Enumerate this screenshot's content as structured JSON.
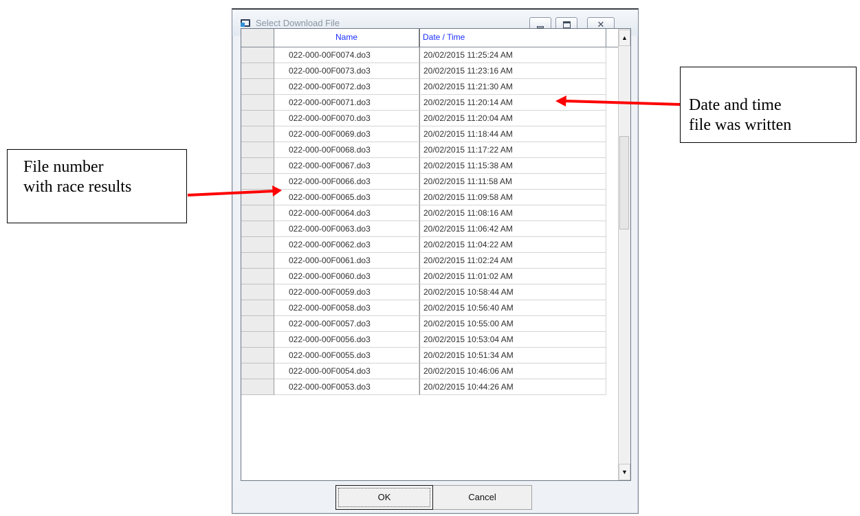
{
  "window": {
    "title": "Select Download File",
    "icon": "app-window-icon",
    "controls": [
      "minimize-icon",
      "maximize-icon",
      "close-icon"
    ]
  },
  "table": {
    "columns": [
      "Name",
      "Date / Time"
    ],
    "rows": [
      {
        "name": "022-000-00F0074.do3",
        "datetime": "20/02/2015 11:25:24 AM"
      },
      {
        "name": "022-000-00F0073.do3",
        "datetime": "20/02/2015 11:23:16 AM"
      },
      {
        "name": "022-000-00F0072.do3",
        "datetime": "20/02/2015 11:21:30 AM"
      },
      {
        "name": "022-000-00F0071.do3",
        "datetime": "20/02/2015 11:20:14 AM"
      },
      {
        "name": "022-000-00F0070.do3",
        "datetime": "20/02/2015 11:20:04 AM"
      },
      {
        "name": "022-000-00F0069.do3",
        "datetime": "20/02/2015 11:18:44 AM"
      },
      {
        "name": "022-000-00F0068.do3",
        "datetime": "20/02/2015 11:17:22 AM"
      },
      {
        "name": "022-000-00F0067.do3",
        "datetime": "20/02/2015 11:15:38 AM"
      },
      {
        "name": "022-000-00F0066.do3",
        "datetime": "20/02/2015 11:11:58 AM"
      },
      {
        "name": "022-000-00F0065.do3",
        "datetime": "20/02/2015 11:09:58 AM"
      },
      {
        "name": "022-000-00F0064.do3",
        "datetime": "20/02/2015 11:08:16 AM"
      },
      {
        "name": "022-000-00F0063.do3",
        "datetime": "20/02/2015 11:06:42 AM"
      },
      {
        "name": "022-000-00F0062.do3",
        "datetime": "20/02/2015 11:04:22 AM"
      },
      {
        "name": "022-000-00F0061.do3",
        "datetime": "20/02/2015 11:02:24 AM"
      },
      {
        "name": "022-000-00F0060.do3",
        "datetime": "20/02/2015 11:01:02 AM"
      },
      {
        "name": "022-000-00F0059.do3",
        "datetime": "20/02/2015 10:58:44 AM"
      },
      {
        "name": "022-000-00F0058.do3",
        "datetime": "20/02/2015 10:56:40 AM"
      },
      {
        "name": "022-000-00F0057.do3",
        "datetime": "20/02/2015 10:55:00 AM"
      },
      {
        "name": "022-000-00F0056.do3",
        "datetime": "20/02/2015 10:53:04 AM"
      },
      {
        "name": "022-000-00F0055.do3",
        "datetime": "20/02/2015 10:51:34 AM"
      },
      {
        "name": "022-000-00F0054.do3",
        "datetime": "20/02/2015 10:46:06 AM"
      },
      {
        "name": "022-000-00F0053.do3",
        "datetime": "20/02/2015 10:44:26 AM"
      }
    ]
  },
  "buttons": {
    "ok": "OK",
    "cancel": "Cancel"
  },
  "annotations": {
    "left": [
      "File number",
      "with race results"
    ],
    "right": [
      "Date and time",
      "file was written"
    ],
    "arrow_color": "#ff0000"
  },
  "colors": {
    "header_text": "#1a2cff",
    "dialog_bg": "#eef2f7"
  }
}
